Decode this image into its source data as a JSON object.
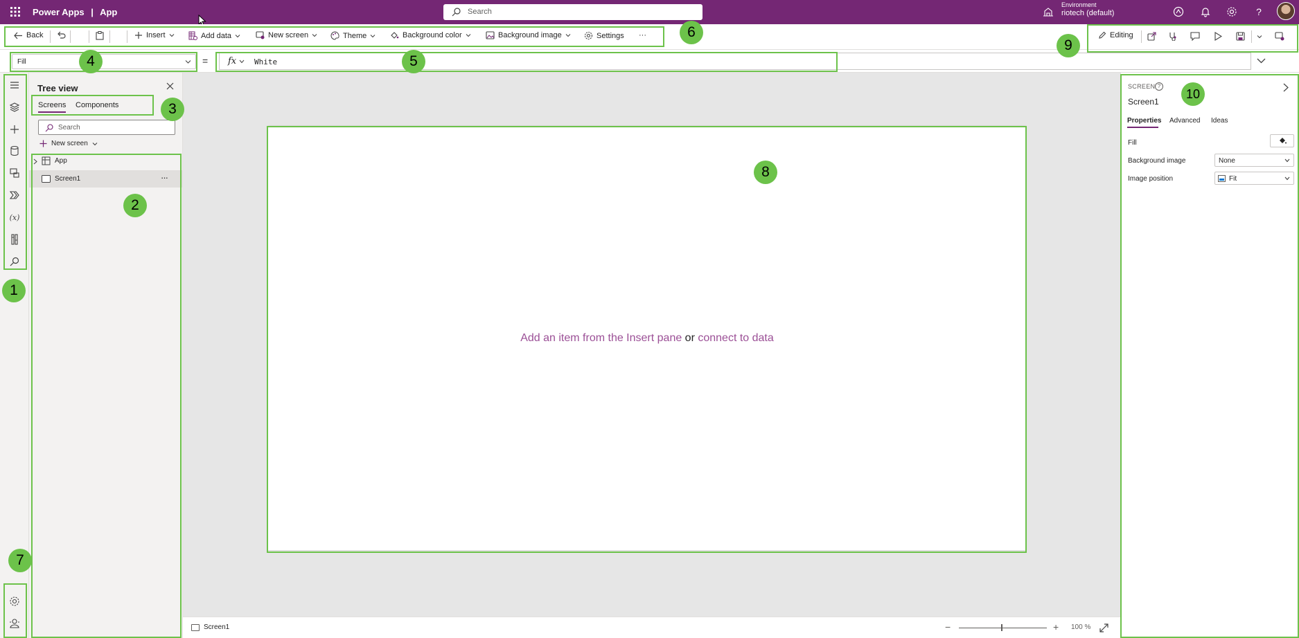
{
  "topbar": {
    "app_name": "Power Apps",
    "separator": "|",
    "app_title": "App",
    "search_placeholder": "Search",
    "environment_label": "Environment",
    "environment_value": "riotech (default)",
    "icons": [
      "waffle-icon",
      "copilot-icon",
      "bell-icon",
      "gear-icon",
      "help-icon"
    ]
  },
  "commandbar": {
    "back": "Back",
    "insert": "Insert",
    "add_data": "Add data",
    "new_screen": "New screen",
    "theme": "Theme",
    "background_color": "Background color",
    "background_image": "Background image",
    "settings": "Settings",
    "more": "···",
    "editing": "Editing"
  },
  "formulabar": {
    "property": "Fill",
    "equals": "=",
    "fx": "fx",
    "formula": "White"
  },
  "treeview": {
    "title": "Tree view",
    "tabs": [
      "Screens",
      "Components"
    ],
    "active_tab": "Screens",
    "search_placeholder": "Search",
    "new_screen": "New screen",
    "items": [
      {
        "label": "App"
      },
      {
        "label": "Screen1",
        "more": "···"
      }
    ]
  },
  "canvas": {
    "msg_part1": "Add an item from the Insert pane",
    "msg_or": " or ",
    "msg_part2": "connect to data"
  },
  "statusbar": {
    "screen": "Screen1",
    "zoom_minus": "−",
    "zoom_plus": "+",
    "zoom": "100 %",
    "zoom_level": 1.0
  },
  "rightpanel": {
    "type_label": "SCREEN",
    "help": "?",
    "name": "Screen1",
    "tabs": [
      "Properties",
      "Advanced",
      "Ideas"
    ],
    "active_tab": "Properties",
    "fill_label": "Fill",
    "bg_image_label": "Background image",
    "bg_image_value": "None",
    "image_position_label": "Image position",
    "image_position_value": "Fit"
  },
  "callouts": [
    "1",
    "2",
    "3",
    "4",
    "5",
    "6",
    "7",
    "8",
    "9",
    "10"
  ],
  "colors": {
    "brand": "#742774",
    "highlight": "#6cc24a",
    "link": "#9b4f96"
  }
}
